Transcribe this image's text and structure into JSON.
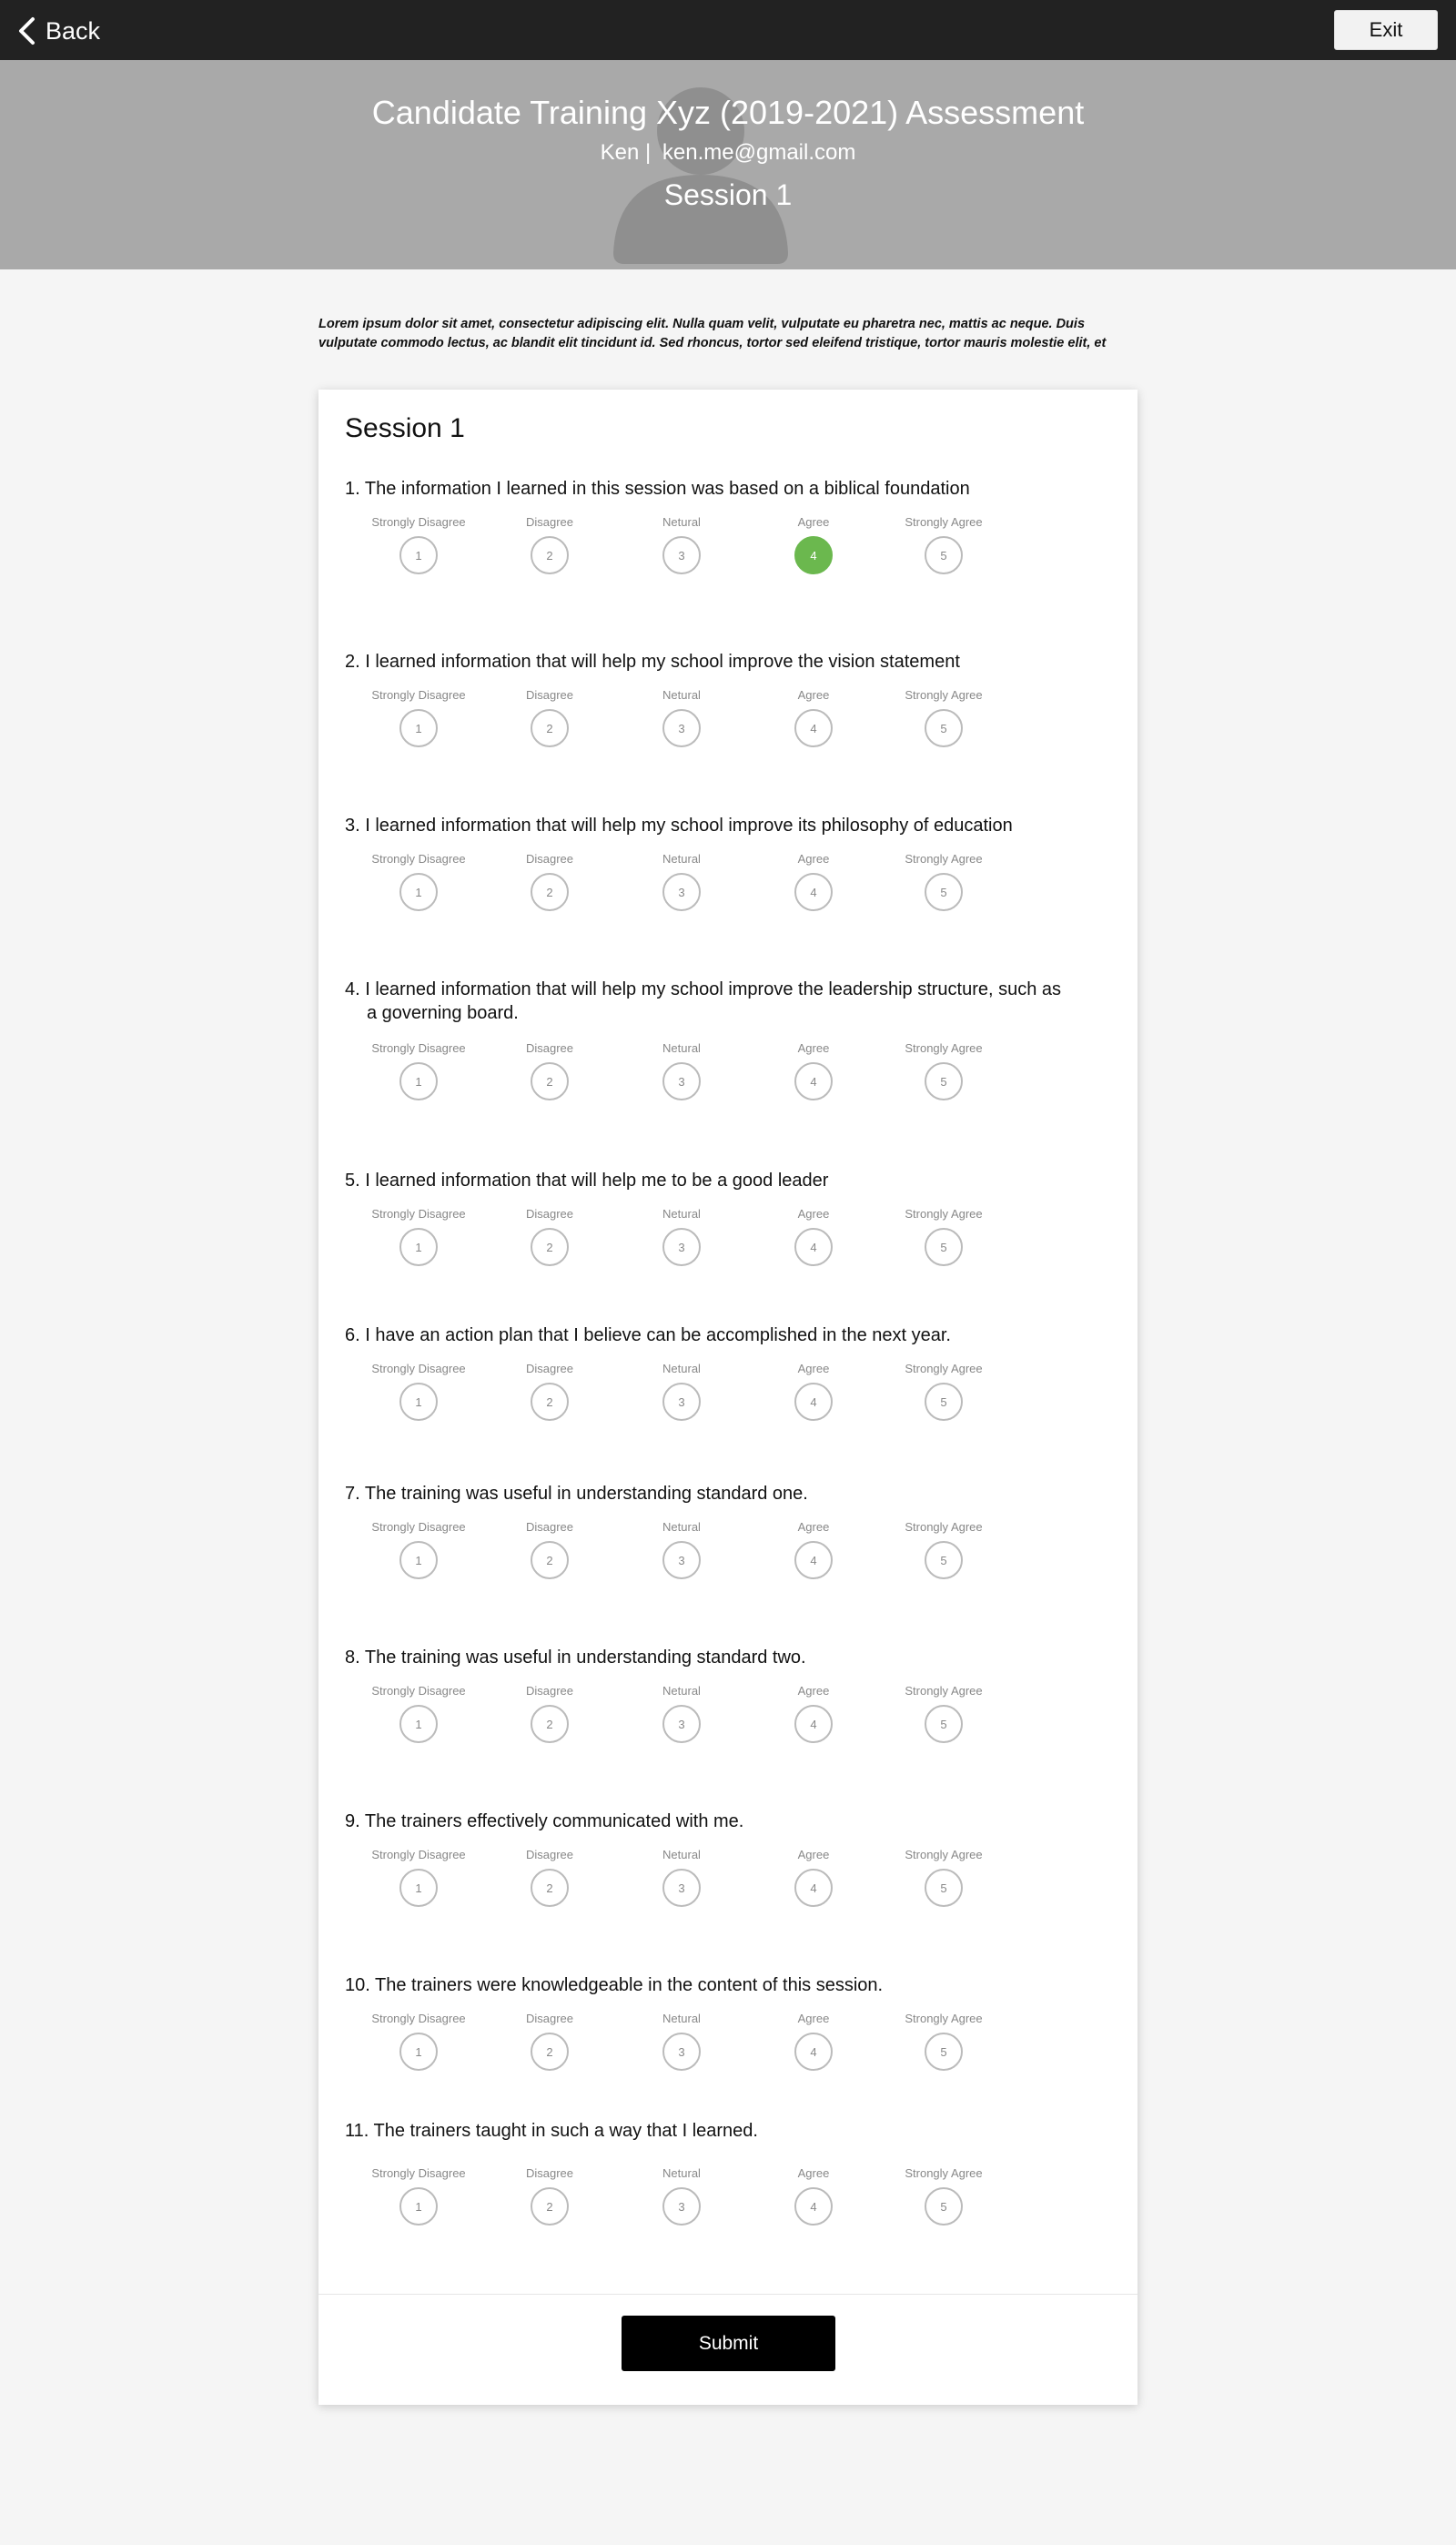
{
  "topbar": {
    "back_label": "Back",
    "exit_label": "Exit"
  },
  "header": {
    "title": "Candidate Training Xyz (2019-2021) Assessment",
    "user_name": "Ken |",
    "user_email": "ken.me@gmail.com",
    "session": "Session 1"
  },
  "intro_text": "Lorem ipsum dolor sit amet, consectetur adipiscing elit. Nulla quam velit, vulputate eu pharetra nec, mattis ac neque. Duis vulputate commodo lectus, ac blandit elit tincidunt id. Sed rhoncus, tortor sed eleifend tristique, tortor mauris molestie elit, et",
  "card": {
    "title": "Session 1",
    "submit_label": "Submit"
  },
  "scale": {
    "labels": [
      "Strongly Disagree",
      "Disagree",
      "Netural",
      "Agree",
      "Strongly Agree"
    ],
    "values": [
      "1",
      "2",
      "3",
      "4",
      "5"
    ]
  },
  "questions": [
    {
      "text": "1. The information I learned in this session was based on a biblical foundation",
      "selected": 4
    },
    {
      "text": "2. I learned information that will help my school improve the vision statement",
      "selected": null
    },
    {
      "text": "3. I learned information that will help my school improve its philosophy of education",
      "selected": null
    },
    {
      "text": "4. I learned information that will help my school improve the leadership structure, such as a governing board.",
      "selected": null
    },
    {
      "text": "5. I learned information that will help me to be a good leader",
      "selected": null
    },
    {
      "text": "6. I have an action plan that I believe can be accomplished in the next year.",
      "selected": null
    },
    {
      "text": "7. The training was useful in understanding standard one.",
      "selected": null
    },
    {
      "text": "8. The training was useful in understanding standard two.",
      "selected": null
    },
    {
      "text": "9. The trainers effectively communicated with me.",
      "selected": null
    },
    {
      "text": "10. The trainers were knowledgeable in the content of this session.",
      "selected": null
    },
    {
      "text": "11. The trainers taught in such a way that I learned.",
      "selected": null
    }
  ],
  "colors": {
    "topbar": "#222222",
    "banner": "#a9a9a9",
    "selected": "#6bb84e",
    "submit": "#000000"
  }
}
